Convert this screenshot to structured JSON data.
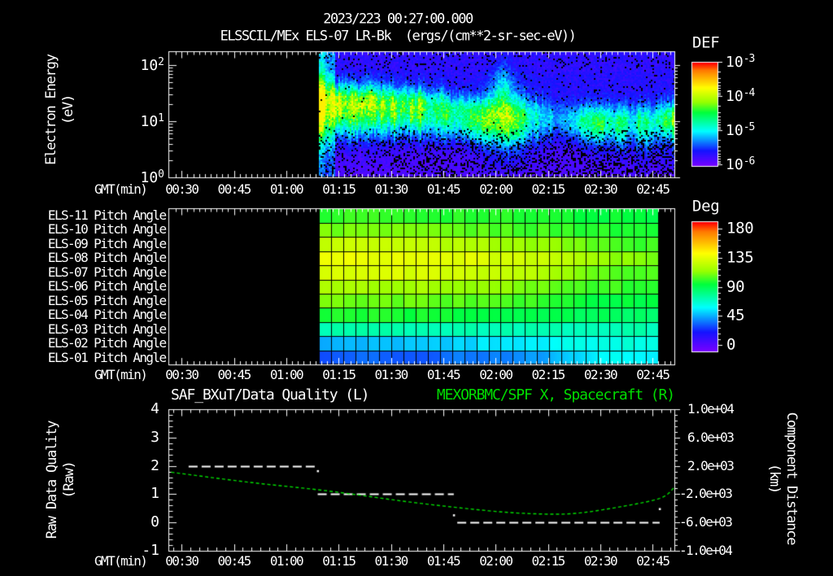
{
  "page": {
    "bg": "#000000",
    "fg": "#ffffff",
    "accent_green": "#00dd00"
  },
  "header": {
    "date_title": "2023/223 00:27:00.000",
    "instrument_title": "ELSSCIL/MEx ELS-07 LR-Bk  (ergs/(cm**2-sr-sec-eV))"
  },
  "gmt_axis": {
    "label": "GMT(min)",
    "tick_labels": [
      "00:30",
      "00:45",
      "01:00",
      "01:15",
      "01:30",
      "01:45",
      "02:00",
      "02:15",
      "02:30",
      "02:45"
    ],
    "tick_interval_min": 15,
    "axis_start": "00:26",
    "axis_end": "02:51"
  },
  "chart_data": [
    {
      "type": "heatmap",
      "name": "electron-energy-spectrogram",
      "ylabel_lines": [
        "Electron Energy",
        "(eV)"
      ],
      "ytick_labels": [
        "10^0",
        "10^1",
        "10^2"
      ],
      "yscale": "log",
      "ylim_ev": [
        1,
        180
      ],
      "colorbar": {
        "title": "DEF",
        "tick_labels": [
          "10^-3",
          "10^-4",
          "10^-5",
          "10^-6"
        ],
        "colormap": "rainbow"
      },
      "data_start": "01:09",
      "data_end": "02:51",
      "band": {
        "u": [
          0.0,
          0.04,
          0.1,
          0.2,
          0.3,
          0.4,
          0.47,
          0.54,
          0.6,
          0.66,
          0.71,
          0.77,
          0.85,
          0.93,
          1.0
        ],
        "center_log_ev": [
          1.38,
          1.35,
          1.33,
          1.3,
          1.28,
          1.22,
          1.17,
          1.13,
          1.12,
          1.1,
          1.08,
          1.0,
          0.98,
          1.0,
          1.05
        ],
        "amplitude": [
          0.5,
          0.46,
          0.43,
          0.4,
          0.34,
          0.27,
          0.24,
          0.2,
          0.2,
          0.1,
          0.09,
          0.18,
          0.2,
          0.28,
          0.32
        ],
        "width_dec": [
          0.24,
          0.23,
          0.21,
          0.2,
          0.19,
          0.18,
          0.19,
          0.2,
          0.19,
          0.18,
          0.17,
          0.19,
          0.19,
          0.2,
          0.2
        ]
      },
      "blobs": [
        {
          "u": 0.005,
          "sigma_u": 0.01,
          "center_log_ev": 1.3,
          "sigma_dec": 0.55,
          "amplitude": 0.25
        },
        {
          "u": 0.44,
          "sigma_u": 0.08,
          "center_log_ev": 0.92,
          "sigma_dec": 0.2,
          "amplitude": 0.11
        },
        {
          "u": 0.525,
          "sigma_u": 0.042,
          "center_log_ev": 1.03,
          "sigma_dec": 0.42,
          "amplitude": 0.22
        },
        {
          "u": 0.515,
          "sigma_u": 0.018,
          "center_log_ev": 1.6,
          "sigma_dec": 0.3,
          "amplitude": 0.13
        },
        {
          "u": 0.78,
          "sigma_u": 0.055,
          "center_log_ev": 1.0,
          "sigma_dec": 0.22,
          "amplitude": 0.15
        },
        {
          "u": 1.0,
          "sigma_u": 0.03,
          "center_log_ev": 1.05,
          "sigma_dec": 0.18,
          "amplitude": 0.14
        }
      ],
      "background_levels": {
        "low_e": 0.15,
        "mid": 0.2,
        "high_e": 0.19
      },
      "noise_level": 0.2
    },
    {
      "type": "heatmap",
      "name": "pitch-angle-panel",
      "rows": [
        {
          "label": "ELS-11 Pitch Angle",
          "angles_deg": [
            100,
            99,
            96,
            94,
            93
          ]
        },
        {
          "label": "ELS-10 Pitch Angle",
          "angles_deg": [
            108,
            106,
            101,
            98,
            96
          ]
        },
        {
          "label": "ELS-09 Pitch Angle",
          "angles_deg": [
            124,
            121,
            112,
            104,
            100
          ]
        },
        {
          "label": "ELS-08 Pitch Angle",
          "angles_deg": [
            133,
            131,
            124,
            112,
            106
          ]
        },
        {
          "label": "ELS-07 Pitch Angle",
          "angles_deg": [
            129,
            127,
            118,
            107,
            102
          ]
        },
        {
          "label": "ELS-06 Pitch Angle",
          "angles_deg": [
            117,
            115,
            108,
            101,
            98
          ]
        },
        {
          "label": "ELS-05 Pitch Angle",
          "angles_deg": [
            107,
            105,
            99,
            94,
            92
          ]
        },
        {
          "label": "ELS-04 Pitch Angle",
          "angles_deg": [
            97,
            95,
            91,
            88,
            86
          ]
        },
        {
          "label": "ELS-03 Pitch Angle",
          "angles_deg": [
            75,
            74,
            74,
            74,
            74
          ]
        },
        {
          "label": "ELS-02 Pitch Angle",
          "angles_deg": [
            50,
            54,
            60,
            66,
            68
          ]
        },
        {
          "label": "ELS-01 Pitch Angle",
          "angles_deg": [
            37,
            39,
            46,
            62,
            58
          ]
        }
      ],
      "colorbar": {
        "title": "Deg",
        "tick_labels": [
          "180",
          "135",
          "90",
          "45",
          "0"
        ],
        "range_deg": [
          0,
          180
        ],
        "colormap": "rainbow"
      },
      "data_start": "01:09",
      "data_end": "02:47",
      "sweep_minutes": 3.3
    },
    {
      "type": "line",
      "name": "quality-distance-plot",
      "title_left": "SAF_BXuT/Data Quality (L)",
      "title_right": "MEXORBMC/SPF X, Spacecraft (R)",
      "ylabel_left_lines": [
        "Raw Data Quality",
        "(Raw)"
      ],
      "ylabel_right_lines": [
        "Component Distance",
        "(km)"
      ],
      "ytick_labels_left": [
        "4",
        "3",
        "2",
        "1",
        "0",
        "-1"
      ],
      "ytick_labels_right": [
        "1.0e+04",
        "6.0e+03",
        "2.0e+03",
        "-2.0e+03",
        "-6.0e+03",
        "-1.0e+04"
      ],
      "ylim_left": [
        -1,
        4
      ],
      "ylim_right_km": [
        -10000,
        10000
      ],
      "quality_segments": [
        {
          "value": 2,
          "t0": "00:32",
          "t1": "01:09"
        },
        {
          "value": 1,
          "t0": "01:09",
          "t1": "01:48"
        },
        {
          "value": 0,
          "t0": "01:49",
          "t1": "02:47"
        }
      ],
      "quality_dots": [
        {
          "t": "01:09",
          "value": 1.82
        },
        {
          "t": "01:48",
          "value": 0.26
        },
        {
          "t": "02:47",
          "value": 0.48
        }
      ],
      "distance_series": {
        "t": [
          "00:27",
          "00:49",
          "01:12",
          "01:36",
          "01:57",
          "02:10",
          "02:22",
          "02:35",
          "02:47",
          "02:51"
        ],
        "km": [
          1100,
          -300,
          -1550,
          -3150,
          -4300,
          -4750,
          -4750,
          -3850,
          -2600,
          -1150
        ]
      },
      "line_colors": {
        "quality": "#ffffff",
        "distance": "#00dd00"
      }
    }
  ]
}
